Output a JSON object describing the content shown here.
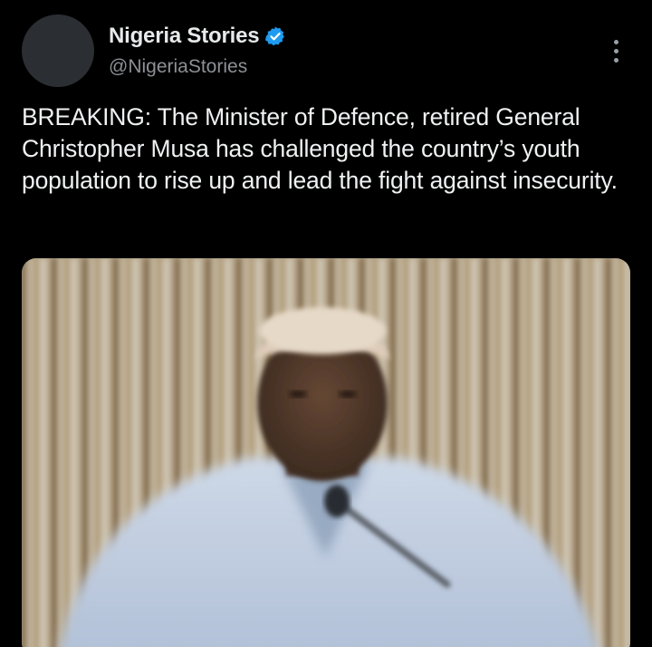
{
  "author": {
    "display_name": "Nigeria Stories",
    "handle": "@NigeriaStories",
    "verified": true,
    "verified_icon": "verified-badge-icon"
  },
  "menu": {
    "icon": "more-options-icon"
  },
  "tweet": {
    "text": "BREAKING: The Minister of Defence, retired General Christopher Musa has challenged the country’s youth population to rise up and lead the fight against insecurity."
  },
  "media": {
    "type": "video-thumbnail"
  },
  "colors": {
    "background": "#000000",
    "text": "#e7e9ea",
    "secondary_text": "#8b9196",
    "verified_blue": "#1d9bf0",
    "avatar_placeholder": "#2b2f33"
  }
}
